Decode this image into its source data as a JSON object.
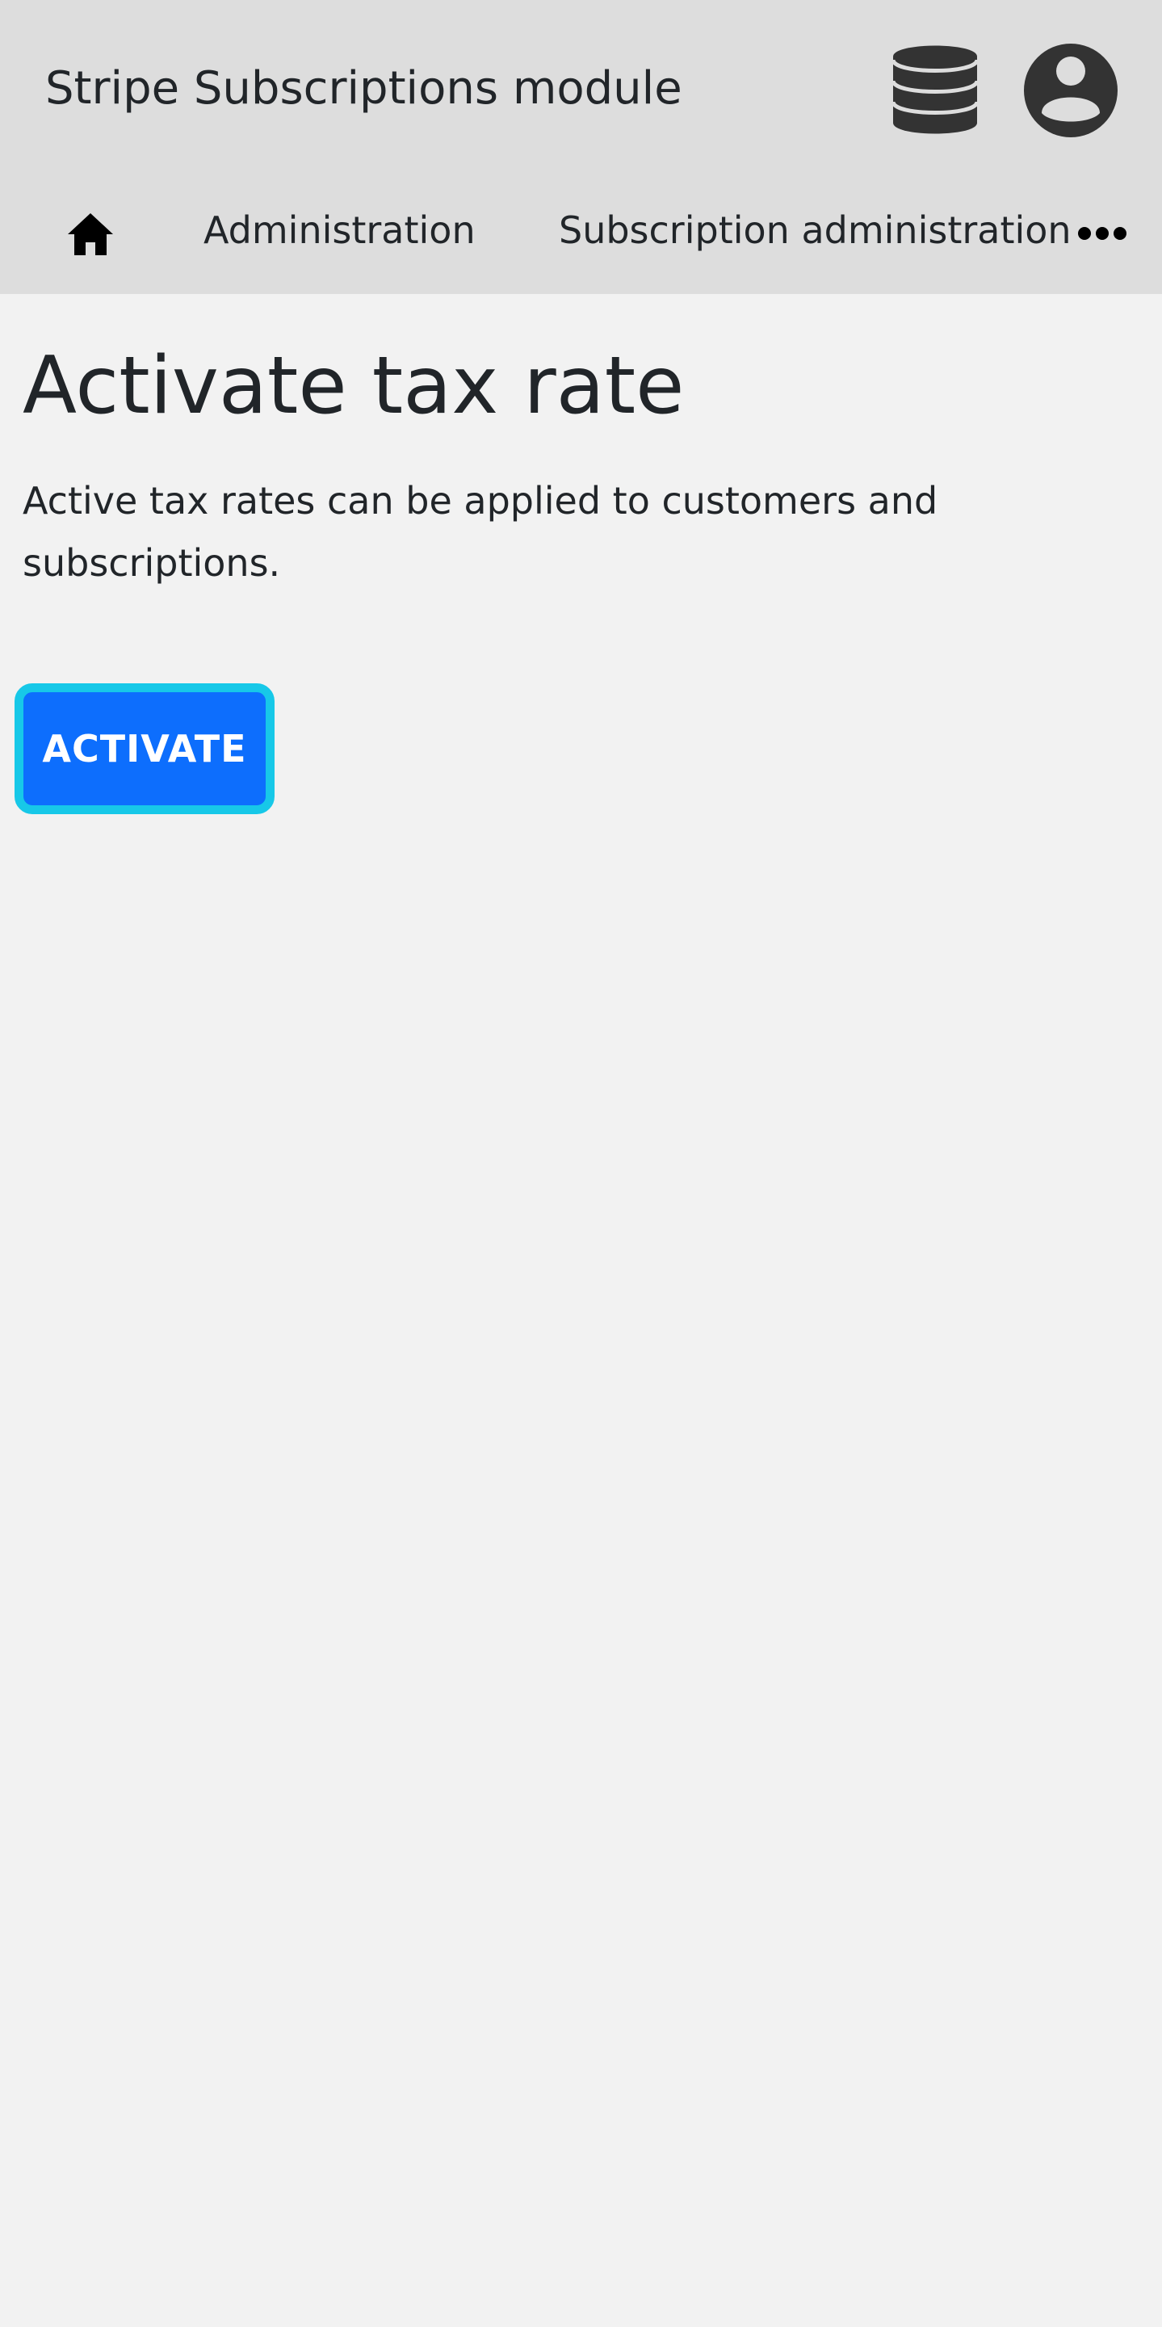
{
  "header": {
    "app_title": "Stripe Subscriptions module",
    "database_icon": "database-icon",
    "user_icon": "user-circle-icon"
  },
  "breadcrumb": {
    "home_icon": "home-icon",
    "items": [
      {
        "label": "Administration"
      },
      {
        "label": "Subscription administration"
      }
    ],
    "more_icon": "ellipsis-icon"
  },
  "main": {
    "title": "Activate tax rate",
    "description": "Active tax rates can be applied to customers and subscriptions.",
    "activate_label": "ACTIVATE"
  },
  "colors": {
    "header_bg": "#dddddd",
    "page_bg": "#f2f2f2",
    "primary_button": "#0d6efd",
    "focus_ring": "#17c8e8",
    "icon": "#333333"
  }
}
